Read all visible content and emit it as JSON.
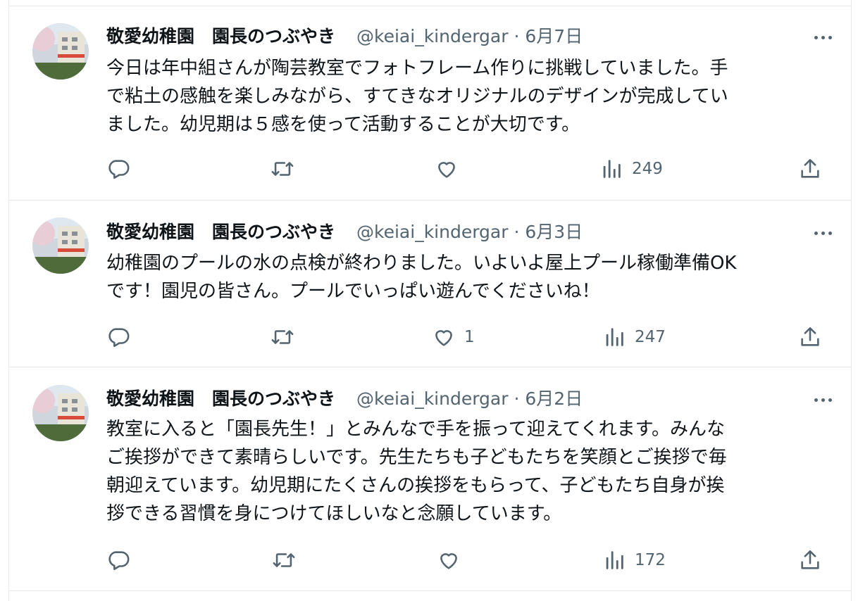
{
  "tweets": [
    {
      "author": "敬愛幼稚園　園長のつぶやき",
      "handle": "@keiai_kindergar",
      "separator": "·",
      "date": "6月7日",
      "text": "今日は年中組さんが陶芸教室でフォトフレーム作りに挑戦していました。手\nで粘土の感触を楽しみながら、すてきなオリジナルのデザインが完成してい\nました。幼児期は５感を使って活動することが大切です。",
      "likes": "",
      "views": "249"
    },
    {
      "author": "敬愛幼稚園　園長のつぶやき",
      "handle": "@keiai_kindergar",
      "separator": "·",
      "date": "6月3日",
      "text": "幼稚園のプールの水の点検が終わりました。いよいよ屋上プール稼働準備OK\nです！園児の皆さん。プールでいっぱい遊んでくださいね！",
      "likes": "1",
      "views": "247"
    },
    {
      "author": "敬愛幼稚園　園長のつぶやき",
      "handle": "@keiai_kindergar",
      "separator": "·",
      "date": "6月2日",
      "text": "教室に入ると「園長先生！」とみんなで手を振って迎えてくれます。みんな\nご挨拶ができて素晴らしいです。先生たちも子どもたちを笑顔とご挨拶で毎\n朝迎えています。幼児期にたくさんの挨拶をもらって、子どもたち自身が挨\n拶できる習慣を身につけてほしいなと念願しています。",
      "likes": "",
      "views": "172"
    }
  ],
  "icons": {
    "reply": "reply-icon",
    "retweet": "retweet-icon",
    "like": "heart-icon",
    "views": "analytics-icon",
    "share": "share-icon",
    "more": "more-icon"
  },
  "colors": {
    "text": "#0f1419",
    "muted": "#536471",
    "border": "#e6e9ec"
  }
}
